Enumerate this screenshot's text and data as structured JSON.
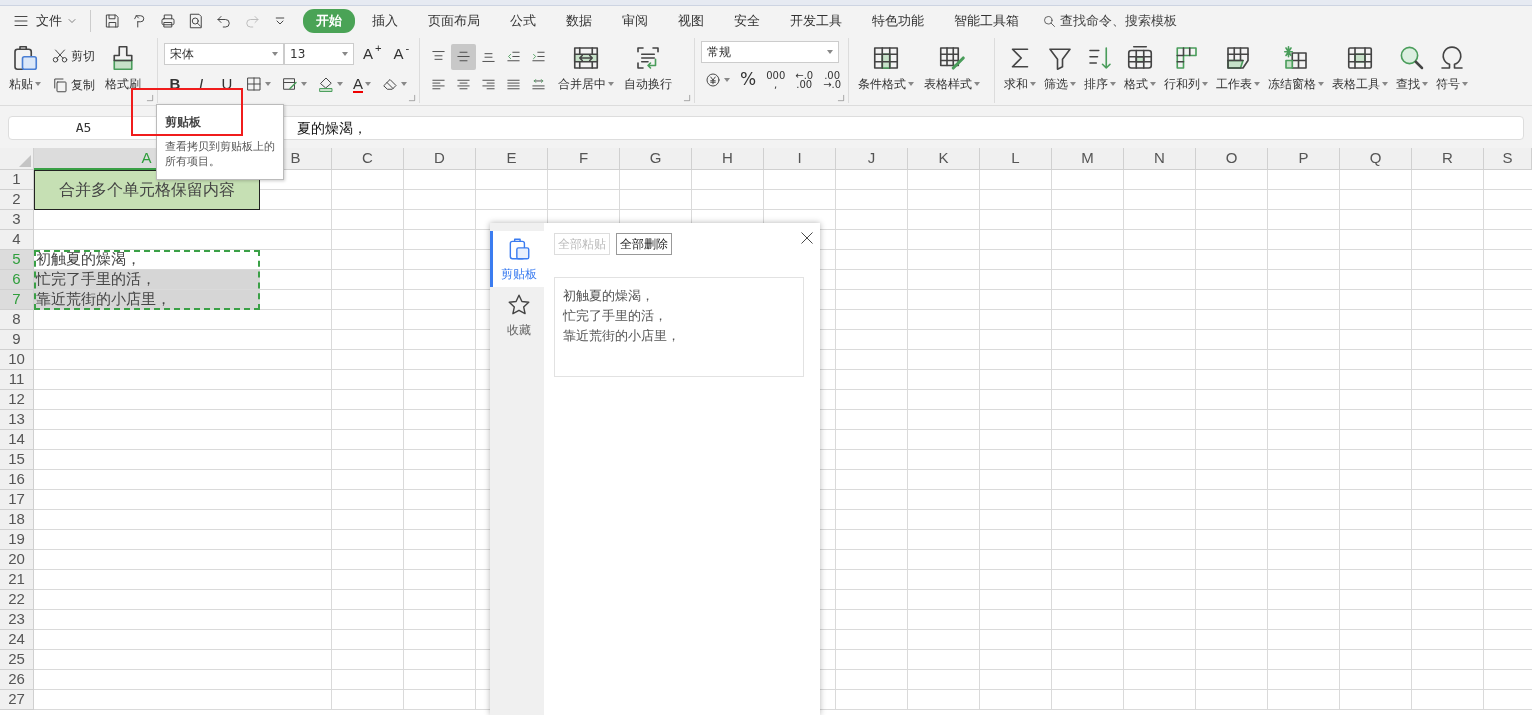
{
  "menu": {
    "file": "文件",
    "quick_access": [
      {
        "kind": "save",
        "disabled": false
      },
      {
        "kind": "convert",
        "disabled": false
      },
      {
        "kind": "print",
        "disabled": false
      },
      {
        "kind": "preview",
        "disabled": false
      },
      {
        "kind": "undo",
        "disabled": false
      },
      {
        "kind": "redo",
        "disabled": true
      },
      {
        "kind": "customize",
        "disabled": false
      }
    ],
    "tabs": [
      {
        "label": "开始",
        "selected": true
      },
      {
        "label": "插入",
        "selected": false
      },
      {
        "label": "页面布局",
        "selected": false
      },
      {
        "label": "公式",
        "selected": false
      },
      {
        "label": "数据",
        "selected": false
      },
      {
        "label": "审阅",
        "selected": false
      },
      {
        "label": "视图",
        "selected": false
      },
      {
        "label": "安全",
        "selected": false
      },
      {
        "label": "开发工具",
        "selected": false
      },
      {
        "label": "特色功能",
        "selected": false
      },
      {
        "label": "智能工具箱",
        "selected": false
      }
    ],
    "search": "查找命令、搜索模板"
  },
  "ribbon": {
    "clipboard": {
      "paste": "粘贴",
      "cut": "剪切",
      "copy": "复制",
      "format_painter": "格式刷"
    },
    "font": {
      "name": "宋体",
      "size": "13",
      "size_buttons": [
        "A$^{+}$",
        "A$^{-}$"
      ],
      "style_buttons": [
        "B",
        "I",
        "U"
      ],
      "color_button": "A"
    },
    "alignment": {
      "buttons": [
        {
          "kind": "align-top",
          "selected": false
        },
        {
          "kind": "align-middle",
          "selected": true
        },
        {
          "kind": "align-bottom",
          "selected": false
        },
        {
          "kind": "indent-dec",
          "selected": false
        },
        {
          "kind": "indent-inc",
          "selected": false
        },
        {
          "kind": "left",
          "selected": false
        },
        {
          "kind": "center",
          "selected": false
        },
        {
          "kind": "right",
          "selected": false
        },
        {
          "kind": "justify",
          "selected": false
        },
        {
          "kind": "distribute",
          "selected": false
        }
      ],
      "merge": "合并居中",
      "wrap": "自动换行"
    },
    "number": {
      "format": "常规",
      "buttons": [
        {
          "kind": "currency"
        },
        {
          "kind": "text",
          "lines": [
            "%"
          ]
        },
        {
          "kind": "stack",
          "lines": [
            "000",
            ","
          ]
        },
        {
          "kind": "stack",
          "lines": [
            "←.0",
            ".00"
          ]
        },
        {
          "kind": "stack",
          "lines": [
            ".00",
            "→.0"
          ]
        }
      ]
    },
    "styles": [
      {
        "label": "条件格式",
        "kind": "condfmt"
      },
      {
        "label": "表格样式",
        "kind": "tablestyle"
      }
    ],
    "tools": [
      {
        "label": "求和",
        "kind": "sum"
      },
      {
        "label": "筛选",
        "kind": "filter"
      },
      {
        "label": "排序",
        "kind": "sort"
      },
      {
        "label": "格式",
        "kind": "format"
      },
      {
        "label": "行和列",
        "kind": "rowcol"
      },
      {
        "label": "工作表",
        "kind": "sheet"
      },
      {
        "label": "冻结窗格",
        "kind": "freeze"
      },
      {
        "label": "表格工具",
        "kind": "tabletool"
      },
      {
        "label": "查找",
        "kind": "find"
      },
      {
        "label": "符号",
        "kind": "symbol"
      }
    ]
  },
  "formula_bar": {
    "cell_ref": "A5",
    "content": "夏的燥渴，"
  },
  "sheet": {
    "columns": [
      {
        "label": "A",
        "selected": true
      },
      {
        "label": "B",
        "selected": false
      },
      {
        "label": "C",
        "selected": false
      },
      {
        "label": "D",
        "selected": false
      },
      {
        "label": "E",
        "selected": false
      },
      {
        "label": "F",
        "selected": false
      },
      {
        "label": "G",
        "selected": false
      },
      {
        "label": "H",
        "selected": false
      },
      {
        "label": "I",
        "selected": false
      },
      {
        "label": "J",
        "selected": false
      },
      {
        "label": "K",
        "selected": false
      },
      {
        "label": "L",
        "selected": false
      },
      {
        "label": "M",
        "selected": false
      },
      {
        "label": "N",
        "selected": false
      },
      {
        "label": "O",
        "selected": false
      },
      {
        "label": "P",
        "selected": false
      },
      {
        "label": "Q",
        "selected": false
      },
      {
        "label": "R",
        "selected": false
      },
      {
        "label": "S",
        "selected": false
      }
    ],
    "rows": [
      {
        "label": "1",
        "selected": false,
        "cell_a": {
          "kind": "title",
          "text": "合并多个单元格保留内容"
        }
      },
      {
        "label": "2",
        "selected": false
      },
      {
        "label": "3",
        "selected": false
      },
      {
        "label": "4",
        "selected": false
      },
      {
        "label": "5",
        "selected": true,
        "cell_a": {
          "kind": "text",
          "text": "初触夏的燥渴，",
          "selected": false,
          "copied": true
        }
      },
      {
        "label": "6",
        "selected": true,
        "cell_a": {
          "kind": "text",
          "text": "忙完了手里的活，",
          "selected": true,
          "copied": true
        }
      },
      {
        "label": "7",
        "selected": true,
        "cell_a": {
          "kind": "text",
          "text": "靠近荒街的小店里，",
          "selected": true,
          "copied": true
        }
      },
      {
        "label": "8",
        "selected": false
      },
      {
        "label": "9",
        "selected": false
      },
      {
        "label": "10",
        "selected": false
      },
      {
        "label": "11",
        "selected": false
      },
      {
        "label": "12",
        "selected": false
      },
      {
        "label": "13",
        "selected": false
      },
      {
        "label": "14",
        "selected": false
      },
      {
        "label": "15",
        "selected": false
      },
      {
        "label": "16",
        "selected": false
      },
      {
        "label": "17",
        "selected": false
      },
      {
        "label": "18",
        "selected": false
      },
      {
        "label": "19",
        "selected": false
      },
      {
        "label": "20",
        "selected": false
      },
      {
        "label": "21",
        "selected": false
      },
      {
        "label": "22",
        "selected": false
      },
      {
        "label": "23",
        "selected": false
      },
      {
        "label": "24",
        "selected": false
      },
      {
        "label": "25",
        "selected": false
      },
      {
        "label": "26",
        "selected": false
      },
      {
        "label": "27",
        "selected": false
      }
    ]
  },
  "tooltip": {
    "title": "剪贴板",
    "text": "查看拷贝到剪贴板上的所有项目。"
  },
  "highlight_frame": true,
  "clipboard_panel": {
    "tabs": [
      {
        "label": "剪贴板",
        "kind": "clip",
        "selected": true
      },
      {
        "label": "收藏",
        "kind": "star",
        "selected": false
      }
    ],
    "buttons": [
      {
        "label": "全部粘贴",
        "disabled": true
      },
      {
        "label": "全部删除",
        "disabled": false
      }
    ],
    "items": [
      {
        "lines": [
          "初触夏的燥渴，",
          "忙完了手里的活，",
          "靠近荒街的小店里，"
        ]
      }
    ]
  }
}
